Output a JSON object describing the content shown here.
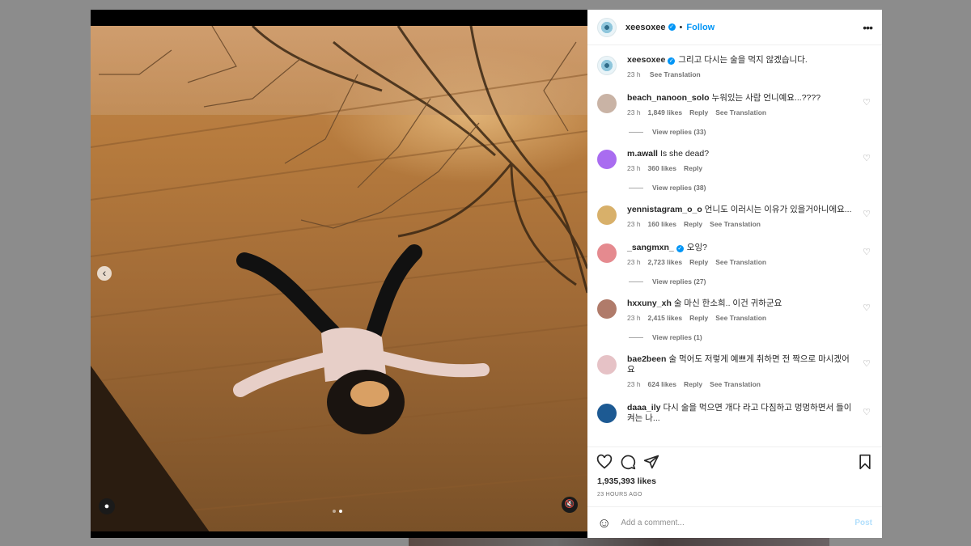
{
  "colors": {
    "accent": "#0095f6",
    "text": "#262626",
    "muted": "#737373",
    "post_disabled": "#b2dffc"
  },
  "media": {
    "prev_icon": "chevron-left-icon",
    "user_tag_icon": "person-icon",
    "mute_icon": "speaker-muted-icon",
    "slide_count": 2,
    "active_slide": 2
  },
  "header": {
    "username": "xeesoxee",
    "separator": "•",
    "follow_label": "Follow",
    "more_icon": "more-horizontal-icon"
  },
  "caption": {
    "username": "xeesoxee",
    "text": "그리고 다시는 술을 먹지 않겠습니다.",
    "time": "23 h",
    "see_translation": "See Translation"
  },
  "comments": [
    {
      "username": "beach_nanoon_solo",
      "text": "누워있는 사람 언니예요...????",
      "time": "23 h",
      "likes": "1,849 likes",
      "reply": "Reply",
      "see_translation": "See Translation",
      "view_replies": "View replies (33)",
      "avatar_color": "#c9b3a5",
      "verified": false
    },
    {
      "username": "m.awall",
      "text": "Is she dead?",
      "time": "23 h",
      "likes": "360 likes",
      "reply": "Reply",
      "see_translation": "",
      "view_replies": "View replies (38)",
      "avatar_color": "#a96cf0",
      "verified": false
    },
    {
      "username": "yennistagram_o_o",
      "text": "언니도 이러시는 이유가 있을거아니에요...",
      "time": "23 h",
      "likes": "160 likes",
      "reply": "Reply",
      "see_translation": "See Translation",
      "view_replies": "",
      "avatar_color": "#d8b06a",
      "verified": false
    },
    {
      "username": "_sangmxn_",
      "text": "오잉?",
      "time": "23 h",
      "likes": "2,723 likes",
      "reply": "Reply",
      "see_translation": "See Translation",
      "view_replies": "View replies (27)",
      "avatar_color": "#e58a8f",
      "verified": true
    },
    {
      "username": "hxxuny_xh",
      "text": "술 마신 한소희.. 이건 귀하군요",
      "time": "23 h",
      "likes": "2,415 likes",
      "reply": "Reply",
      "see_translation": "See Translation",
      "view_replies": "View replies (1)",
      "avatar_color": "#b07b6a",
      "verified": false
    },
    {
      "username": "bae2been",
      "text": "술 먹어도 저렇게 예쁘게 취하면 전 짝으로 마시겠어요",
      "time": "23 h",
      "likes": "624 likes",
      "reply": "Reply",
      "see_translation": "See Translation",
      "view_replies": "",
      "avatar_color": "#e6c2c6",
      "verified": false
    },
    {
      "username": "daaa_ily",
      "text": "다시 술을 먹으면 개다 라고 다짐하고 멍멍하면서 들이켜는 나...",
      "time": "",
      "likes": "",
      "reply": "",
      "see_translation": "",
      "view_replies": "",
      "avatar_color": "#1d5a93",
      "verified": false
    }
  ],
  "actions": {
    "like_icon": "heart-icon",
    "comment_icon": "comment-icon",
    "share_icon": "paper-plane-icon",
    "save_icon": "bookmark-icon"
  },
  "likes_count": "1,935,393 likes",
  "posted_ago": "23 HOURS AGO",
  "comment_box": {
    "emoji_icon": "emoji-icon",
    "placeholder": "Add a comment...",
    "post_label": "Post"
  }
}
